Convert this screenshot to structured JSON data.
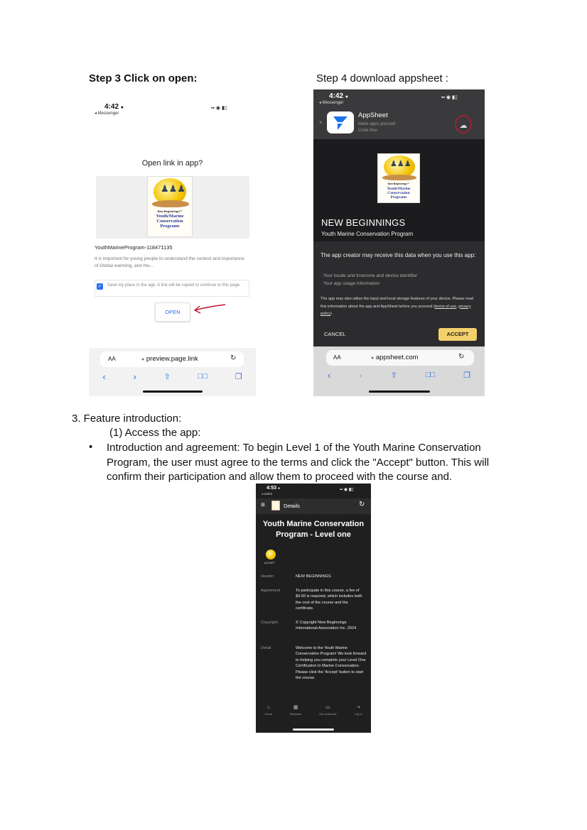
{
  "step3_heading": "Step 3 Click on open:",
  "step4_heading": "Step 4 download appsheet :",
  "shot1": {
    "time": "4:42",
    "back": "◂ Messenger",
    "dialog_title": "Open link in app?",
    "app_id": "YouthMarineProgram-118471135",
    "description": "It is important for young people to understand the context and importance of Global warming, and the...",
    "checkbox_label": "Save my place in the app. A link will be copied to continue to this page.",
    "open_button": "OPEN",
    "aa": "AA",
    "url": "preview.page.link"
  },
  "logo": {
    "line1": "New Beginnings™",
    "line2": "Youth/Marine",
    "line3": "Conservation",
    "line4": "Programs"
  },
  "shot2": {
    "time": "4:42",
    "back": "◂ Messenger",
    "app_name": "AppSheet",
    "app_tagline_1": "Make apps yourself.",
    "app_tagline_2": "Code-free.",
    "brand": "NEW BEGINNINGS",
    "program": "Youth Marine Conservation Program",
    "notice": "The app creator may receive this data when you use this app:",
    "data_1": "· Your locale and timezone and device identifier",
    "data_2": "· Your app usage information",
    "fine_print": "The app may also utilize the input and local storage features of your device. Please read this information about the app and AppSheet before you proceed",
    "terms_link": "terms of use",
    "privacy_link": "privacy policy",
    "cancel": "CANCEL",
    "accept": "ACCEPT",
    "aa": "AA",
    "url": "appsheet.com"
  },
  "section": {
    "item3": "3.  Feature introduction:",
    "sub1": "(1)   Access the app:",
    "bullet": "•",
    "paragraph": "Introduction and agreement: To begin Level 1 of the Youth Marine Conservation Program, the user must agree to the terms and click the \"Accept\" button. This will confirm their participation and allow them to proceed with the course and."
  },
  "shot3": {
    "time": "4:53",
    "back": "◂ Safari",
    "appbar_title": "Details",
    "title": "Youth Marine Conservation Program - Level one",
    "accept_caption": "ACCEPT",
    "rows": [
      {
        "label": "Header",
        "value": "NEW BEGINNINGS"
      },
      {
        "label": "Agreement",
        "value": "To participate in this course, a fee of $9.50 is required, which includes both the cost of the course and the certificate."
      },
      {
        "label": "Copyright",
        "value": "© Copyright New Beginnings International Association Inc. 2024"
      },
      {
        "label": "Detail",
        "value": "Welcome to the Youth Marine Conservation Program! We look forward to helping you complete your Level One Certification in Marine Conservation. Please click the 'Accept' button to start the course."
      }
    ],
    "nav": [
      {
        "icon": "home-icon",
        "label": "Home"
      },
      {
        "icon": "book-icon",
        "label": "Materials"
      },
      {
        "icon": "certificate-icon",
        "label": "Get certificate"
      },
      {
        "icon": "login-icon",
        "label": "Log in"
      }
    ]
  }
}
